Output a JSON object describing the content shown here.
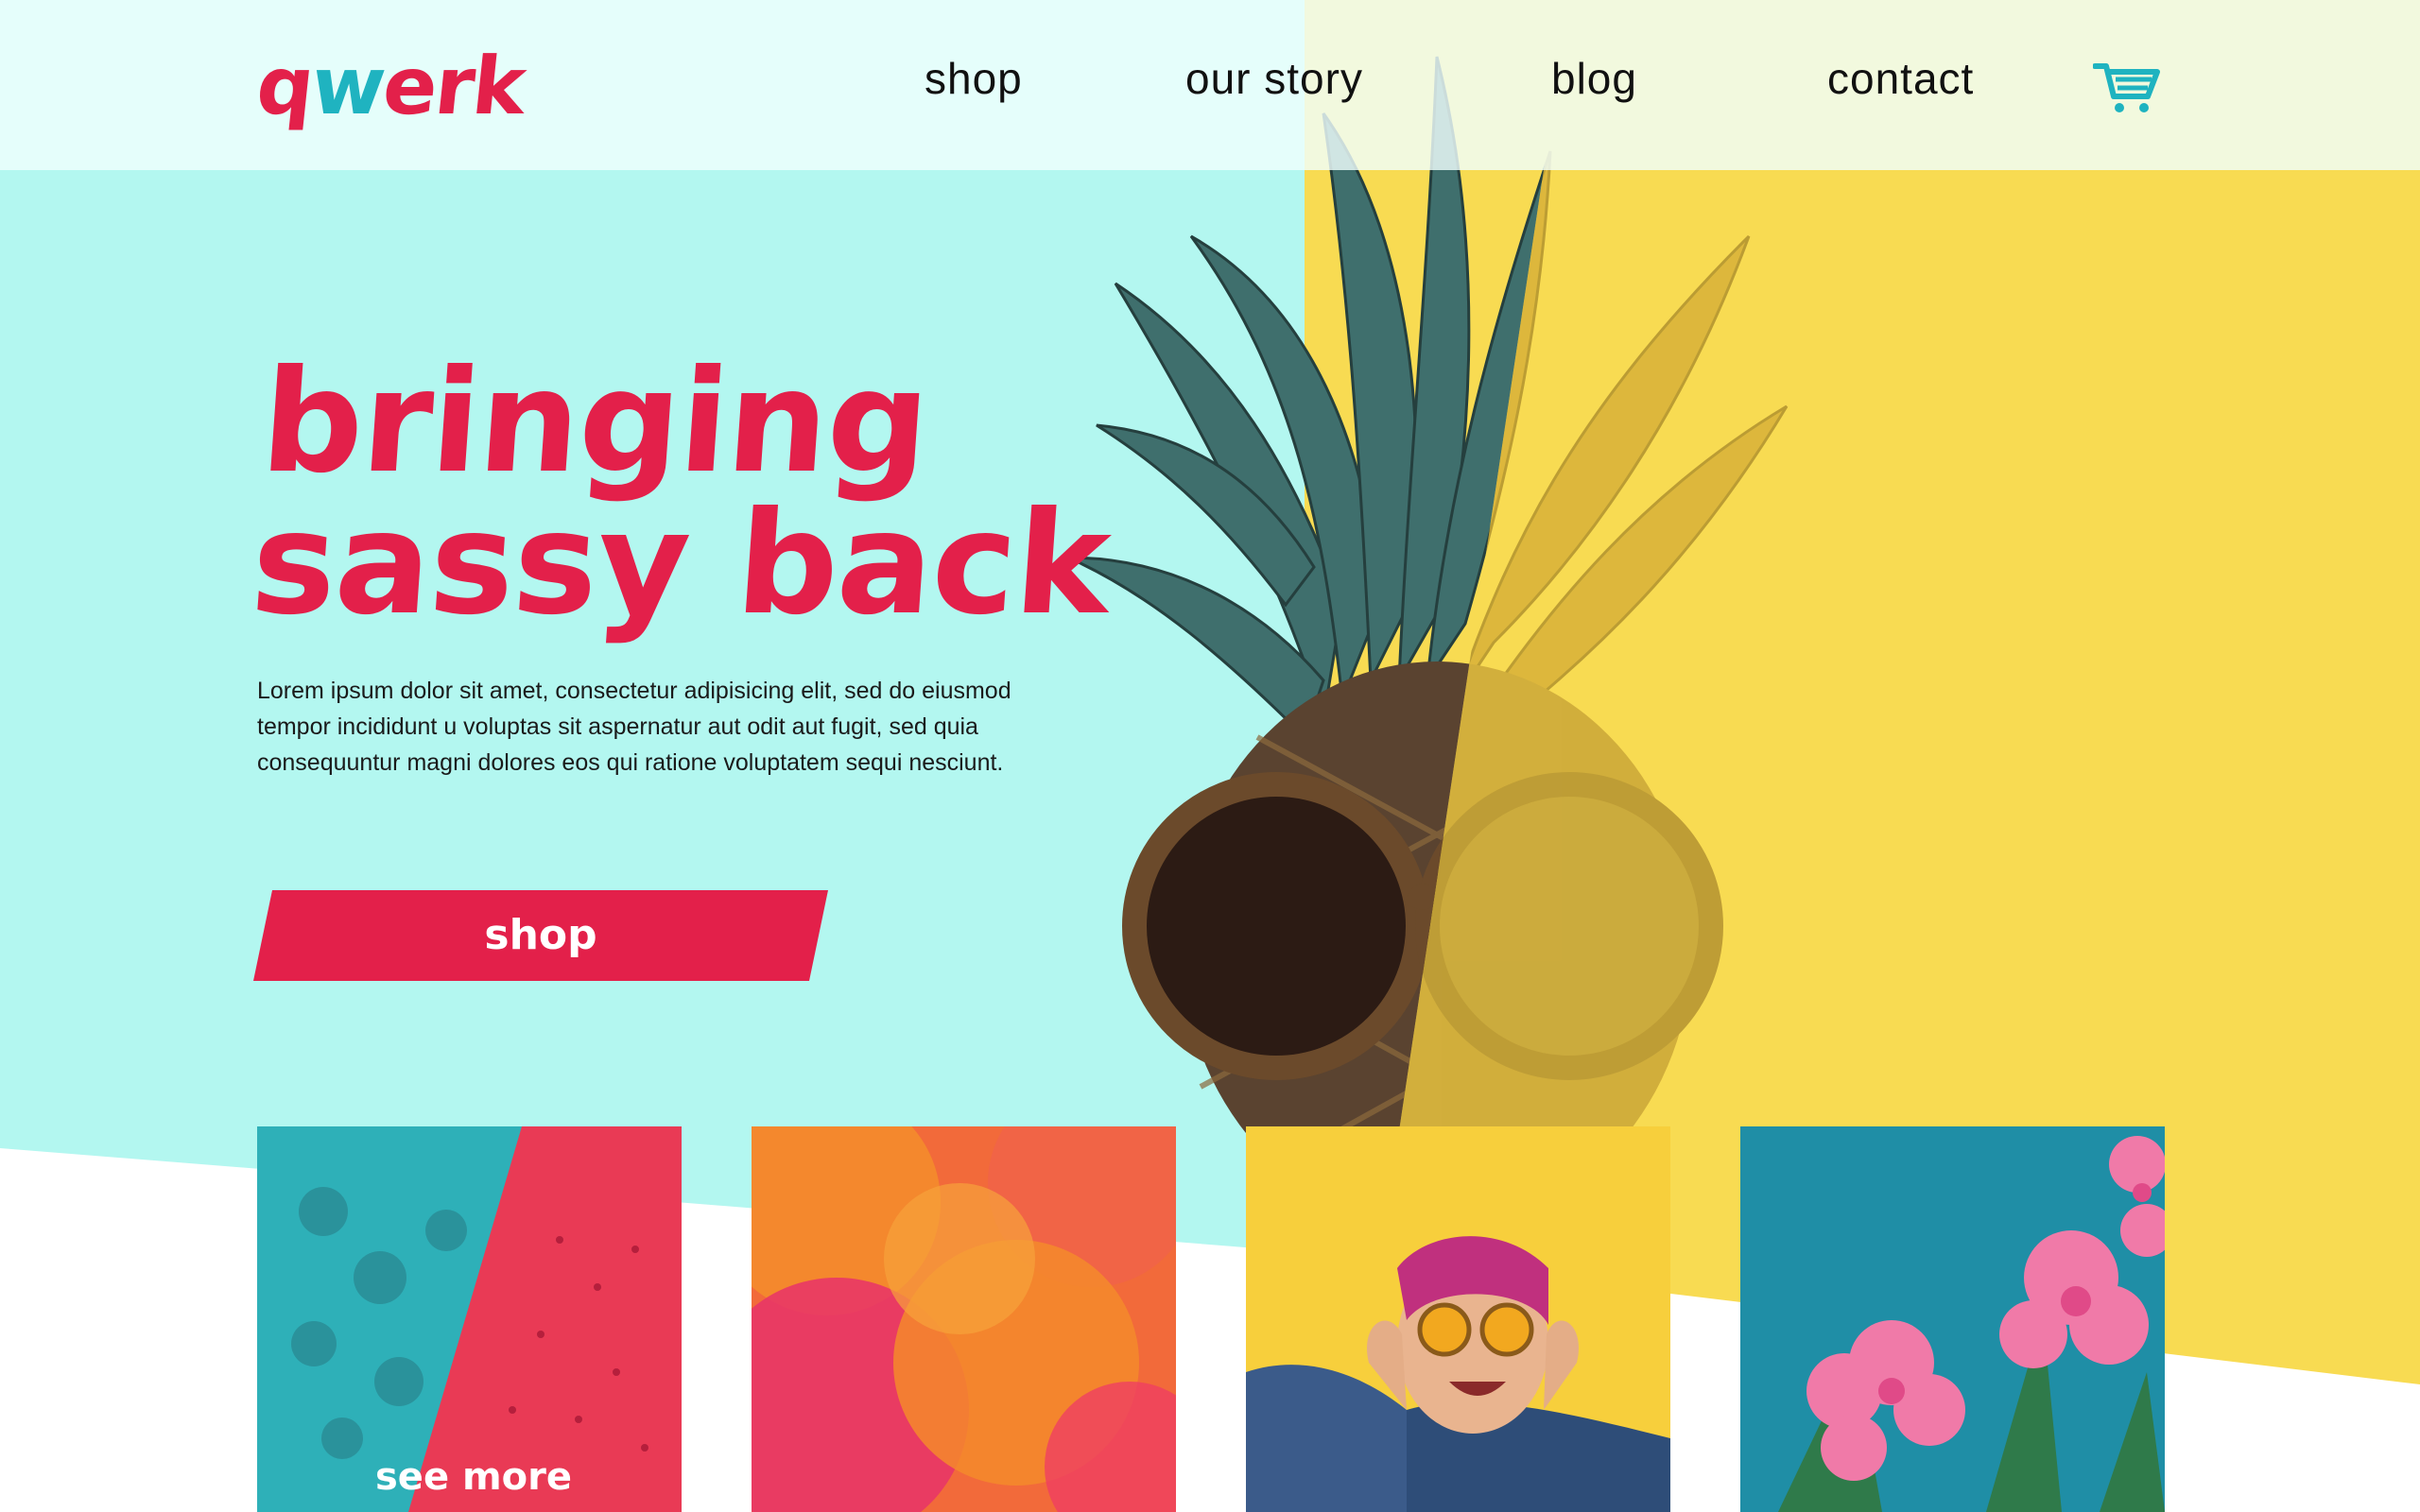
{
  "brand": {
    "logo_q": "q",
    "logo_w": "w",
    "logo_rest": "erk"
  },
  "nav": {
    "items": [
      {
        "label": "shop"
      },
      {
        "label": "our story"
      },
      {
        "label": "blog"
      },
      {
        "label": "contact"
      }
    ],
    "cart_icon": "shopping-cart-icon"
  },
  "hero": {
    "title_line1": "bringing",
    "title_line2": "sassy back",
    "body": "Lorem ipsum dolor sit amet, consectetur adipisicing elit, sed do eiusmod tempor incididunt u voluptas sit aspernatur aut odit aut fugit, sed quia consequuntur magni dolores eos qui ratione voluptatem sequi nesciunt.",
    "cta_label": "shop"
  },
  "tiles": [
    {
      "image": "berries-and-dragonfruit",
      "link_label": "see more"
    },
    {
      "image": "orange-pink-ink-cloud"
    },
    {
      "image": "laughing-woman-in-sunglasses"
    },
    {
      "image": "pink-flowers-on-teal"
    }
  ],
  "colors": {
    "accent_pink": "#e3204a",
    "accent_teal": "#1fb3c0",
    "mint_background": "#b3f7f0",
    "yellow_background": "#f8db52",
    "nav_background": "#f0fffd",
    "text_dark": "#111111"
  }
}
